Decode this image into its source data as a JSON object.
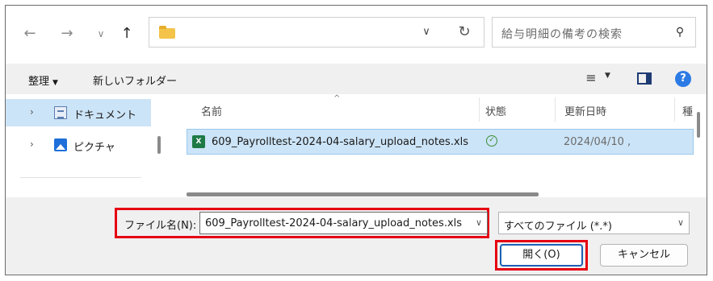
{
  "address_bar": {
    "back_icon": "arrow-left-icon",
    "forward_icon": "arrow-right-icon",
    "recent_icon": "chevron-down-icon",
    "up_icon": "arrow-up-icon",
    "path": "",
    "refresh_icon": "refresh-icon"
  },
  "search": {
    "placeholder": "給与明細の備考の検索",
    "icon": "search-icon"
  },
  "toolbar": {
    "organize_label": "整理",
    "new_folder_label": "新しいフォルダー"
  },
  "nav": {
    "items": [
      {
        "label": "ドキュメント",
        "icon": "documents-icon",
        "selected": true
      },
      {
        "label": "ピクチャ",
        "icon": "pictures-icon",
        "selected": false
      }
    ]
  },
  "file_list": {
    "columns": [
      "名前",
      "状態",
      "更新日時",
      "種"
    ],
    "rows": [
      {
        "name": "609_Payrolltest-2024-04-salary_upload_notes.xls",
        "status_icon": "synced-check-icon",
        "modified": "2024/04/10 ,"
      }
    ]
  },
  "bottom": {
    "filename_label": "ファイル名(N):",
    "filename_value": "609_Payrolltest-2024-04-salary_upload_notes.xls",
    "filetype_value": "すべてのファイル (*.*)",
    "open_label": "開く(O)",
    "cancel_label": "キャンセル"
  },
  "colors": {
    "highlight": "#e60012",
    "selection": "#cce4f7",
    "accent": "#1f5fb4"
  }
}
